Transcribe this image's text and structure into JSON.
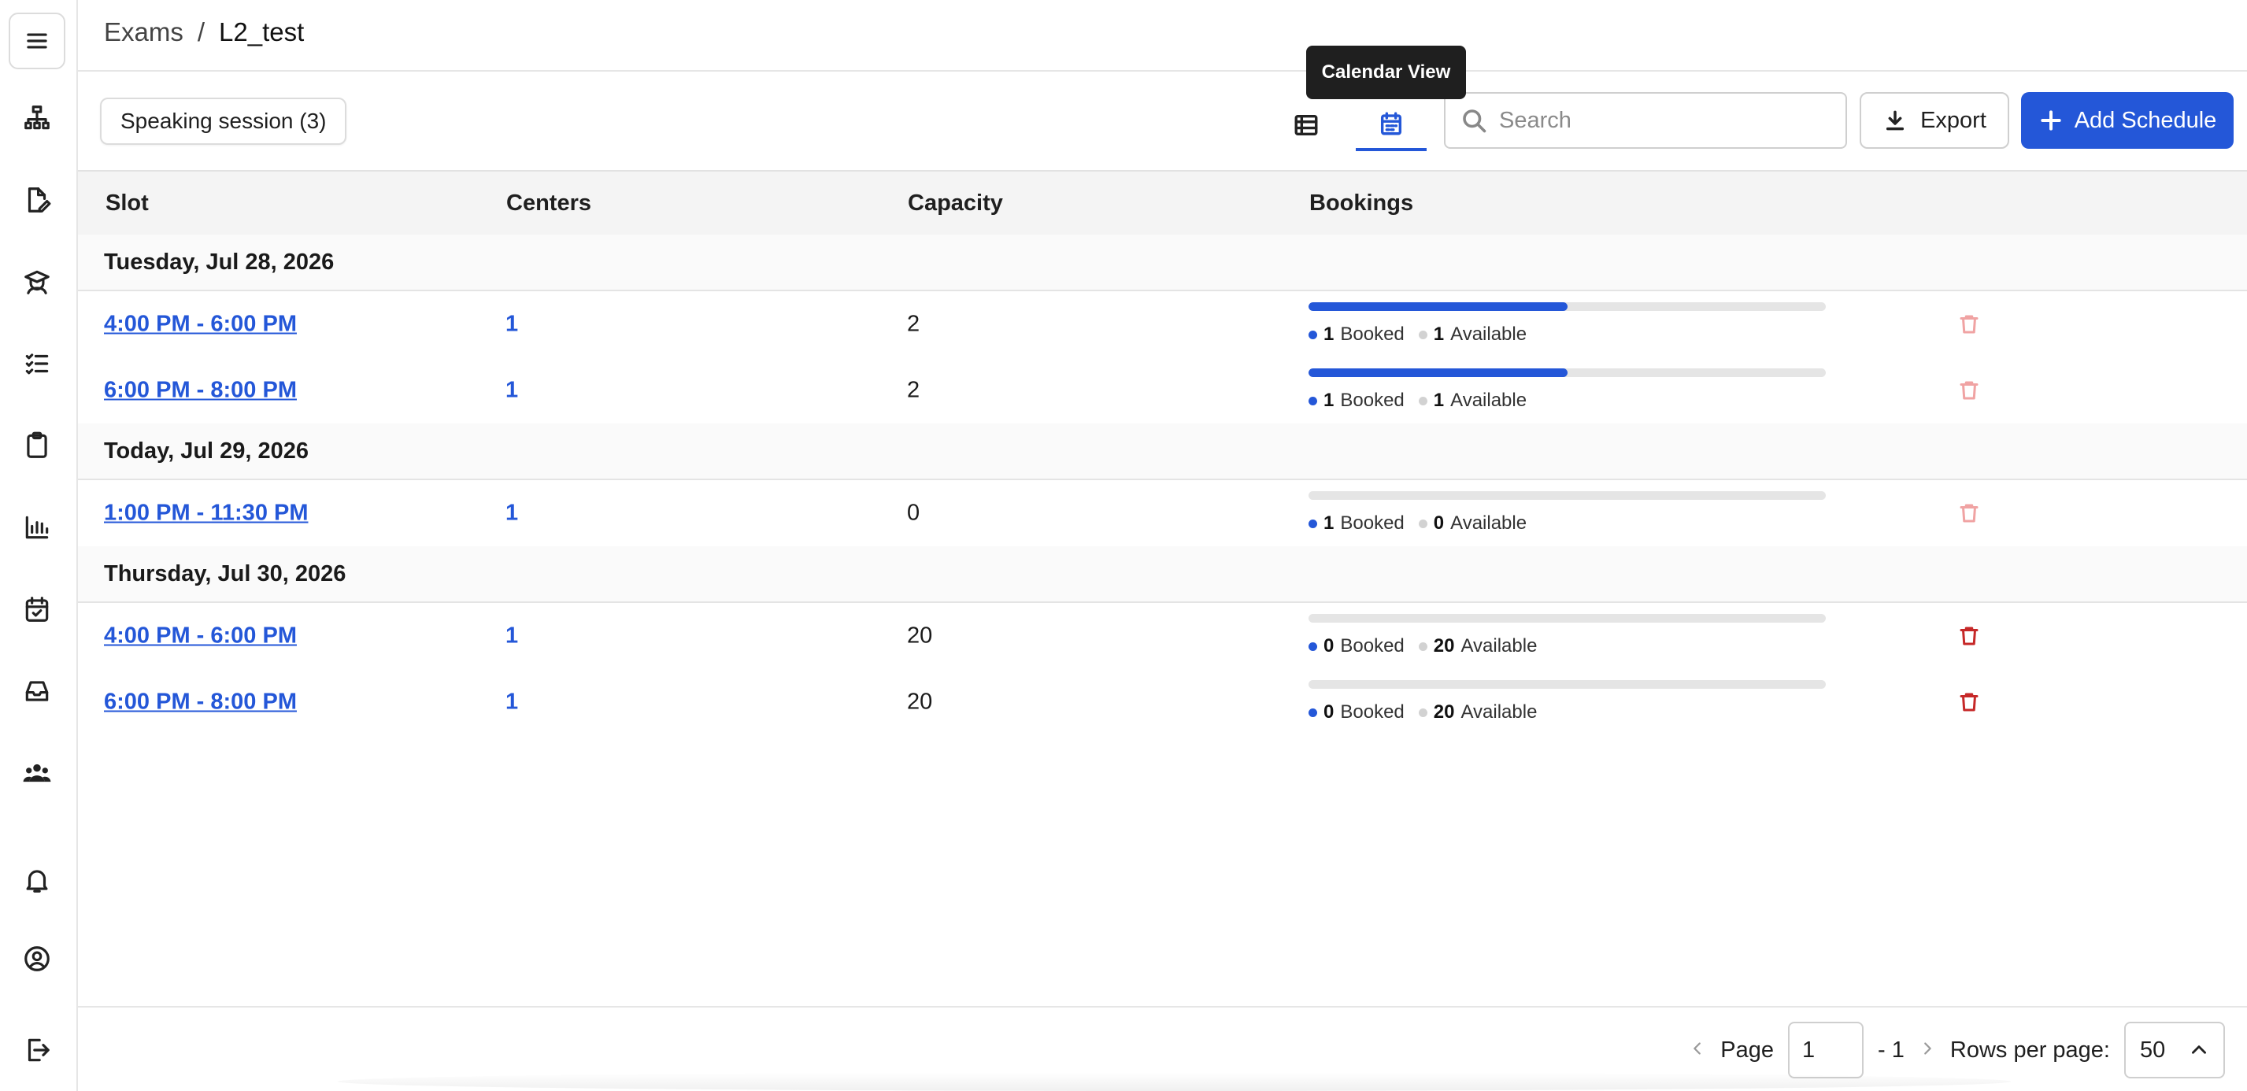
{
  "breadcrumb": {
    "root": "Exams",
    "separator": "/",
    "current": "L2_test"
  },
  "tooltip": "Calendar View",
  "session_chip": "Speaking session (3)",
  "search": {
    "placeholder": "Search",
    "value": ""
  },
  "toolbar": {
    "export_label": "Export",
    "add_label": "Add Schedule"
  },
  "columns": [
    "Slot",
    "Centers",
    "Capacity",
    "Bookings"
  ],
  "booking_labels": {
    "booked": "Booked",
    "available": "Available"
  },
  "groups": [
    {
      "date": "Tuesday, Jul 28, 2026",
      "rows": [
        {
          "slot": "4:00 PM - 6:00 PM",
          "centers": "1",
          "capacity": "2",
          "booked": "1",
          "available": "1",
          "fill": 0.5,
          "delete_enabled": false
        },
        {
          "slot": "6:00 PM - 8:00 PM",
          "centers": "1",
          "capacity": "2",
          "booked": "1",
          "available": "1",
          "fill": 0.5,
          "delete_enabled": false
        }
      ]
    },
    {
      "date": "Today, Jul 29, 2026",
      "rows": [
        {
          "slot": "1:00 PM - 11:30 PM",
          "centers": "1",
          "capacity": "0",
          "booked": "1",
          "available": "0",
          "fill": 0,
          "delete_enabled": false
        }
      ]
    },
    {
      "date": "Thursday, Jul 30, 2026",
      "rows": [
        {
          "slot": "4:00 PM - 6:00 PM",
          "centers": "1",
          "capacity": "20",
          "booked": "0",
          "available": "20",
          "fill": 0,
          "delete_enabled": true
        },
        {
          "slot": "6:00 PM - 8:00 PM",
          "centers": "1",
          "capacity": "20",
          "booked": "0",
          "available": "20",
          "fill": 0,
          "delete_enabled": true
        }
      ]
    }
  ],
  "pagination": {
    "page_label": "Page",
    "page_value": "1",
    "of_label": "- 1",
    "rows_label": "Rows per page:",
    "rows_value": "50"
  },
  "sidebar_icons": [
    "menu-icon",
    "hierarchy-icon",
    "edit-document-icon",
    "graduate-icon",
    "checklist-icon",
    "clipboard-icon",
    "bar-chart-icon",
    "calendar-check-icon",
    "inbox-icon",
    "users-icon",
    "bell-icon",
    "account-icon",
    "logout-icon"
  ],
  "colors": {
    "accent": "#2457d8",
    "danger": "#c62828",
    "danger_disabled": "#f0a3a3"
  }
}
